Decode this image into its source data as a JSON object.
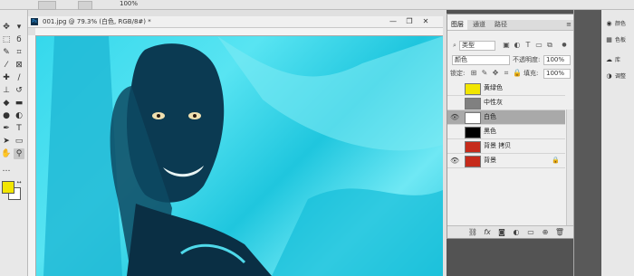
{
  "options_bar": {
    "zoom": "100%"
  },
  "document": {
    "title": "001.jpg @ 79.3% (白色, RGB/8#) *",
    "ps_icon": "Ps"
  },
  "layers_panel": {
    "tabs": [
      {
        "label": "图层",
        "active": true
      },
      {
        "label": "通道",
        "active": false
      },
      {
        "label": "路径",
        "active": false
      }
    ],
    "filter_kind": "类型",
    "blend_mode": "颜色",
    "opacity_label": "不透明度:",
    "opacity_value": "100%",
    "lock_label": "锁定:",
    "fill_label": "填充:",
    "fill_value": "100%",
    "layers": [
      {
        "name": "黄绿色",
        "visible": false,
        "color": "#f2e600",
        "selected": false
      },
      {
        "name": "中性灰",
        "visible": false,
        "color": "#808080",
        "selected": false
      },
      {
        "name": "白色",
        "visible": true,
        "color": "#ffffff",
        "selected": true
      },
      {
        "name": "黑色",
        "visible": false,
        "color": "#000000",
        "selected": false
      },
      {
        "name": "背景 拷贝",
        "visible": false,
        "color": "#c62b1b",
        "selected": false
      },
      {
        "name": "背景",
        "visible": true,
        "color": "#c62b1b",
        "selected": false,
        "locked": true
      }
    ]
  },
  "dock": {
    "items": [
      {
        "label": "颜色",
        "icon": "color-wheel-icon"
      },
      {
        "label": "色板",
        "icon": "swatches-icon"
      },
      {
        "label": "库",
        "icon": "libraries-icon"
      },
      {
        "label": "调整",
        "icon": "adjustments-icon"
      }
    ]
  },
  "colors": {
    "foreground": "#f2e600",
    "background": "#ffffff"
  }
}
